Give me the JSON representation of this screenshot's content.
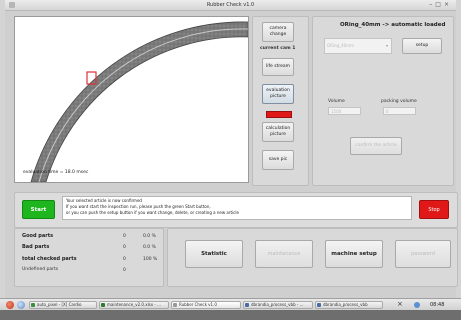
{
  "window": {
    "title": "Rubber Check v1.0"
  },
  "image_view": {
    "evaluation_text": "evaluation time = 18.0 msec"
  },
  "camera_panel": {
    "camera_change": "camera change",
    "current_cam": "current cam 1",
    "life_stream": "life stream",
    "evaluation_picture": "evaluation picture",
    "calculation_picture": "calculation picture",
    "save_pic": "save pic"
  },
  "article_panel": {
    "title": "ORing_40mm -> automatic loaded",
    "select_value": "ORing_40mm",
    "setup": "setup",
    "volume_label": "Volume",
    "packing_label": "packing volume",
    "volume_value": "1500",
    "packing_value": "0",
    "confirm": "confirm the article"
  },
  "message": {
    "start": "Start",
    "stop": "Stop",
    "line1": "Your selected article is now confirmed",
    "line2": "If you want start the inspection run, please push the green Start button,",
    "line3": "or you can push the setup button if you want change, delete, or creating a new article"
  },
  "stats": {
    "good_label": "Good parts",
    "good_count": "0",
    "good_pct": "0.0 %",
    "bad_label": "Bad parts",
    "bad_count": "0",
    "bad_pct": "0.0 %",
    "total_label": "total checked parts",
    "total_count": "0",
    "total_pct": "100 %",
    "undef_label": "Undefined parts",
    "undef_count": "0"
  },
  "actions": {
    "statistic": "Statistic",
    "maintenance": "maintenance",
    "machine_setup": "machine setup",
    "password": "password"
  },
  "taskbar": {
    "task1": "auto_pixel - [X] Cardio",
    "task2": "maintenance_v2.0.xlsx - ...",
    "task3": "Rubber Check v1.0",
    "task4": "dbrandia_process_vbb - ...",
    "task5": "dbrandia_process_vbb",
    "clock": "08:48"
  },
  "colors": {
    "start_green": "#1eb51e",
    "stop_red": "#e01818",
    "defect_box": "#e0303a"
  }
}
